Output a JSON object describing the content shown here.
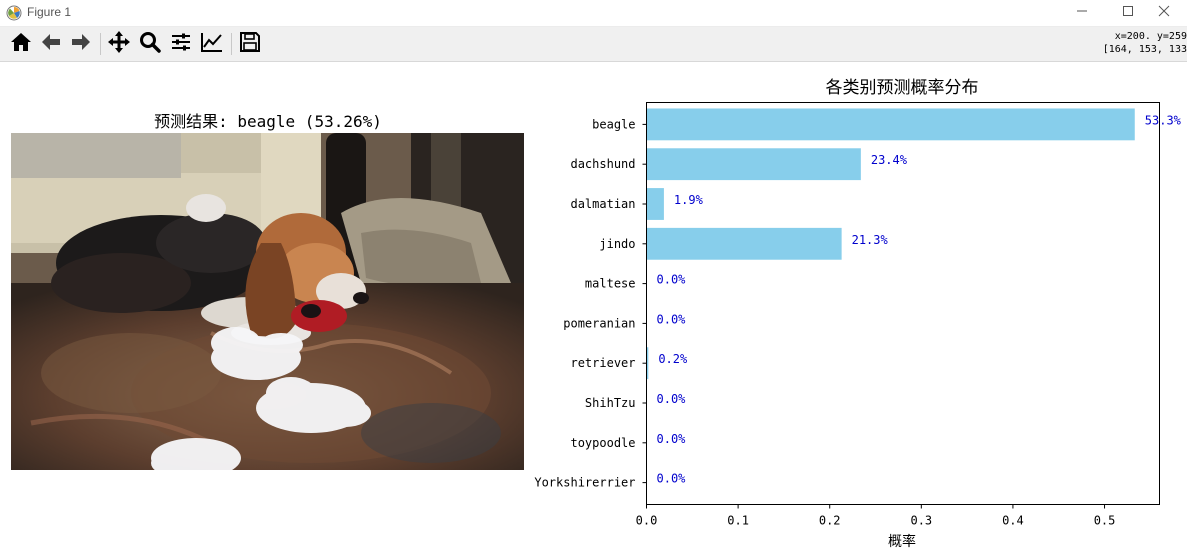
{
  "window": {
    "title": "Figure 1",
    "minimize_icon": "minimize-icon",
    "maximize_icon": "maximize-icon",
    "close_icon": "close-icon"
  },
  "toolbar": {
    "icons": [
      "home-icon",
      "back-arrow-icon",
      "forward-arrow-icon",
      "pan-icon",
      "zoom-icon",
      "configure-subplots-icon",
      "edit-axis-icon",
      "save-icon"
    ],
    "coord_line1": "x=200. y=259",
    "coord_line2": "[164, 153, 133"
  },
  "image_panel": {
    "title": "预测结果: beagle (53.26%)"
  },
  "chart_data": {
    "type": "bar",
    "orientation": "horizontal",
    "title": "各类别预测概率分布",
    "xlabel": "概率",
    "ylabel": "",
    "categories": [
      "beagle",
      "dachshund",
      "dalmatian",
      "jindo",
      "maltese",
      "pomeranian",
      "retriever",
      "ShihTzu",
      "toypoodle",
      "Yorkshirerrier"
    ],
    "values": [
      0.533,
      0.234,
      0.019,
      0.213,
      0.0,
      0.0,
      0.002,
      0.0,
      0.0,
      0.0
    ],
    "value_labels": [
      "53.3%",
      "23.4%",
      "1.9%",
      "21.3%",
      "0.0%",
      "0.0%",
      "0.2%",
      "0.0%",
      "0.0%",
      "0.0%"
    ],
    "xlim": [
      0,
      0.56
    ],
    "xticks": [
      0.0,
      0.1,
      0.2,
      0.3,
      0.4,
      0.5
    ],
    "xtick_labels": [
      "0.0",
      "0.1",
      "0.2",
      "0.3",
      "0.4",
      "0.5"
    ],
    "bar_color": "#87ceeb",
    "label_color": "#0000cd",
    "grid": false,
    "legend": "none"
  }
}
